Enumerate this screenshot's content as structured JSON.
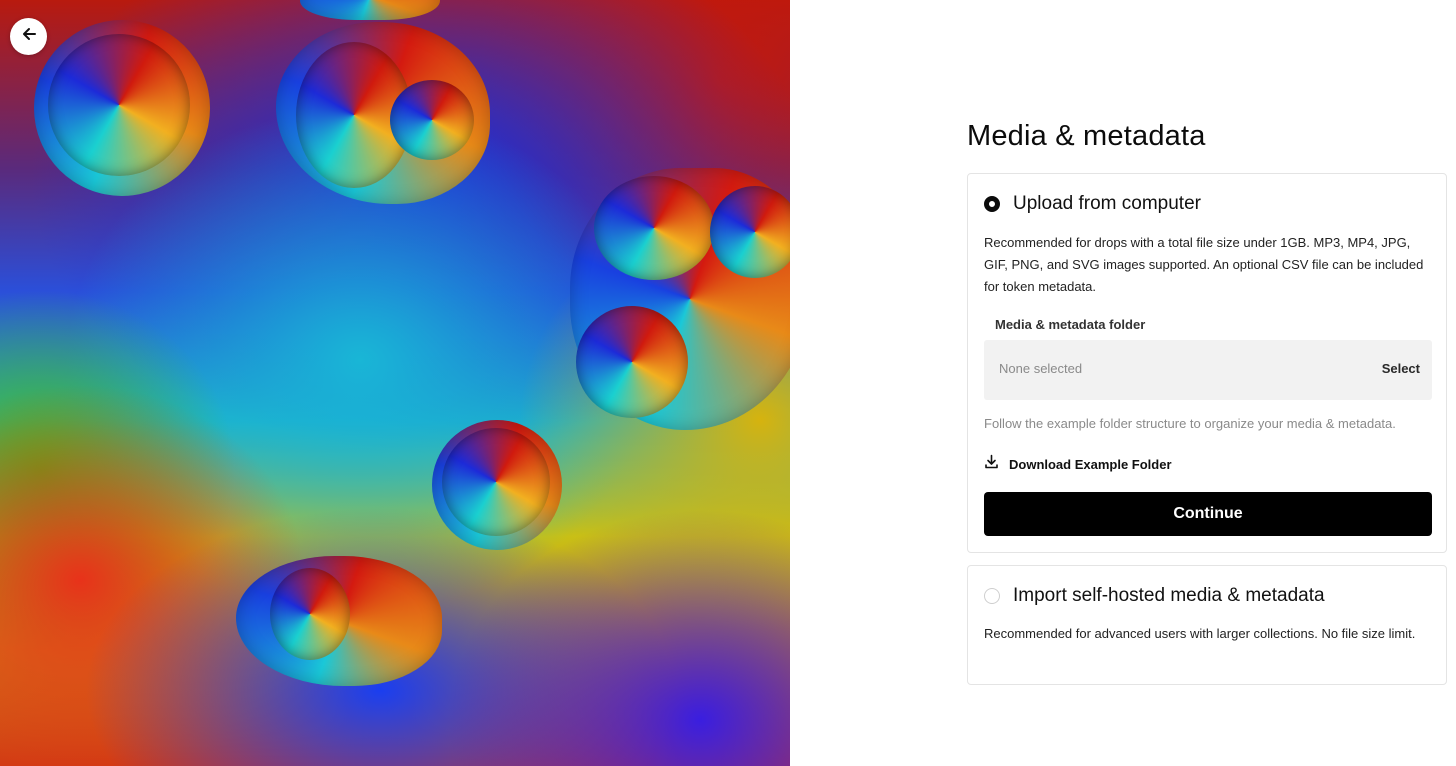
{
  "header": {
    "back_icon": "arrow-left-icon"
  },
  "artwork": {
    "colors": [
      "#c3180c",
      "#1d2fd8",
      "#19b6d6",
      "#d6b30e",
      "#4ab818",
      "#e8321a"
    ]
  },
  "main": {
    "title": "Media & metadata",
    "upload_option": {
      "label": "Upload from computer",
      "selected": true,
      "description": "Recommended for drops with a total file size under 1GB. MP3, MP4, JPG, GIF, PNG, and SVG images supported. An optional CSV file can be included for token metadata.",
      "folder_field": {
        "label": "Media & metadata folder",
        "value": "None selected",
        "action": "Select"
      },
      "hint": "Follow the example folder structure to organize your media & metadata.",
      "download_label": "Download Example Folder",
      "download_icon": "download-icon",
      "continue_label": "Continue"
    },
    "import_option": {
      "label": "Import self-hosted media & metadata",
      "selected": false,
      "description": "Recommended for advanced users with larger collections. No file size limit."
    }
  }
}
